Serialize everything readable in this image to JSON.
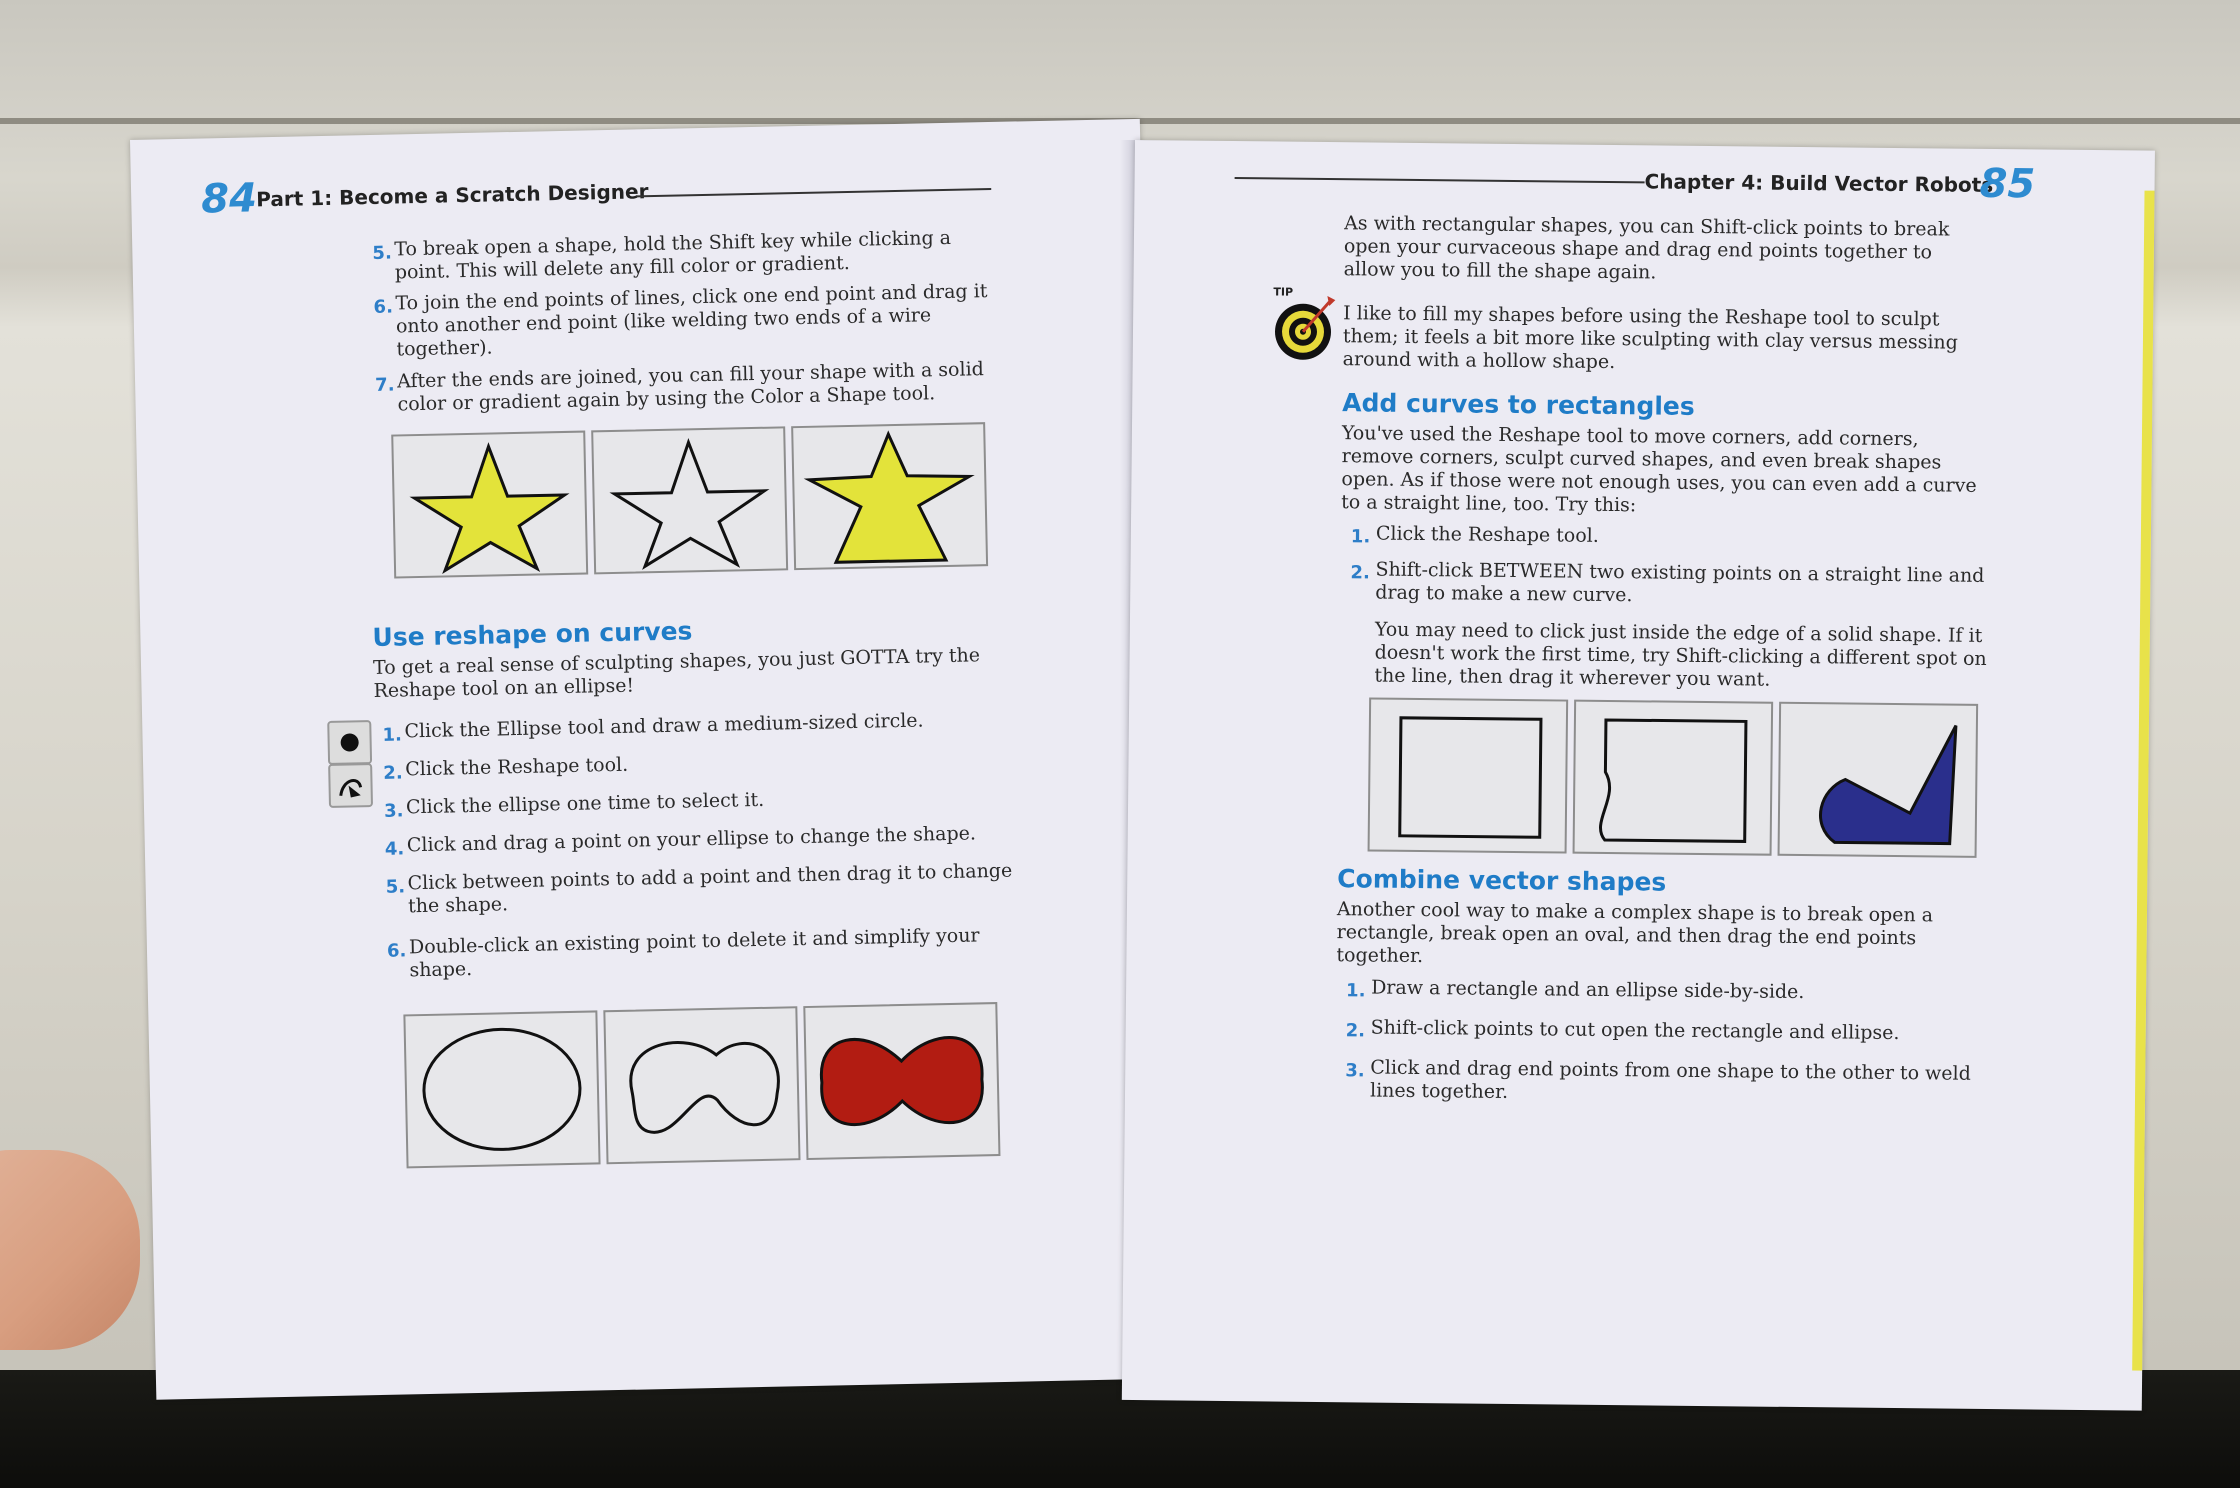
{
  "left_page": {
    "page_number": "84",
    "running_head": "Part 1: Become a Scratch Designer",
    "steps_top": [
      {
        "n": "5.",
        "text_lines": [
          "To break open a shape, hold the Shift key while clicking a",
          "point. This will delete any fill color or gradient."
        ]
      },
      {
        "n": "6.",
        "text_lines": [
          "To join the end points of lines, click one end point and drag it",
          "onto another end point (like welding two ends of a wire",
          "together)."
        ]
      },
      {
        "n": "7.",
        "text_lines": [
          "After the ends are joined, you can fill your shape with a solid",
          "color or gradient again by using the Color a Shape tool."
        ]
      }
    ],
    "heading": "Use reshape on curves",
    "intro_lines": [
      "To get a real sense of sculpting shapes, you just GOTTA try the",
      "Reshape tool on an ellipse!"
    ],
    "steps": [
      {
        "n": "1.",
        "text_lines": [
          "Click the Ellipse tool and draw a medium-sized circle."
        ]
      },
      {
        "n": "2.",
        "text_lines": [
          "Click the Reshape tool."
        ]
      },
      {
        "n": "3.",
        "text_lines": [
          "Click the ellipse one time to select it."
        ]
      },
      {
        "n": "4.",
        "text_lines": [
          "Click and drag a point on your ellipse to change the shape."
        ]
      },
      {
        "n": "5.",
        "text_lines": [
          "Click between points to add a point and then drag it to change",
          "the shape."
        ]
      },
      {
        "n": "6.",
        "text_lines": [
          "Double-click an existing point to delete it and simplify your",
          "shape."
        ]
      }
    ],
    "colors": {
      "star_fill": "#e3e33a",
      "bowtie_fill": "#b21c12"
    }
  },
  "right_page": {
    "page_number": "85",
    "running_head": "Chapter 4: Build Vector Robots",
    "para1_lines": [
      "As with rectangular shapes, you can Shift-click points to break",
      "open your curvaceous shape and drag end points together to",
      "allow you to fill the shape again."
    ],
    "tip_label": "TIP",
    "tip_lines": [
      "I like to fill my shapes before using the Reshape tool to sculpt",
      "them; it feels a bit more like sculpting with clay versus messing",
      "around with a hollow shape."
    ],
    "heading1": "Add curves to rectangles",
    "intro1_lines": [
      "You've used the Reshape tool to move corners, add corners,",
      "remove corners, sculpt curved shapes, and even break shapes",
      "open. As if those were not enough uses, you can even add a curve",
      "to a straight line, too. Try this:"
    ],
    "steps1": [
      {
        "n": "1.",
        "text_lines": [
          "Click the Reshape tool."
        ]
      },
      {
        "n": "2.",
        "text_lines": [
          "Shift-click BETWEEN two existing points on a straight line and",
          "drag to make a new curve."
        ]
      }
    ],
    "note_lines": [
      "You may need to click just inside the edge of a solid shape. If it",
      "doesn't work the first time, try Shift-clicking a different spot on",
      "the line, then drag it wherever you want."
    ],
    "heading2": "Combine vector shapes",
    "intro2_lines": [
      "Another cool way to make a complex shape is to break open a",
      "rectangle, break open an oval, and then drag the end points",
      "together."
    ],
    "steps2": [
      {
        "n": "1.",
        "text_lines": [
          "Draw a rectangle and an ellipse side-by-side."
        ]
      },
      {
        "n": "2.",
        "text_lines": [
          "Shift-click points to cut open the rectangle and ellipse."
        ]
      },
      {
        "n": "3.",
        "text_lines": [
          "Click and drag end points from one shape to the other to weld",
          "lines together."
        ]
      }
    ],
    "colors": {
      "shape_fill": "#2a2f8c",
      "tip_yellow": "#e6d93a"
    }
  },
  "colors": {
    "accent_blue": "#2e7ec8",
    "page": "#ecebf3",
    "edge_yellow": "#e8e24a"
  }
}
